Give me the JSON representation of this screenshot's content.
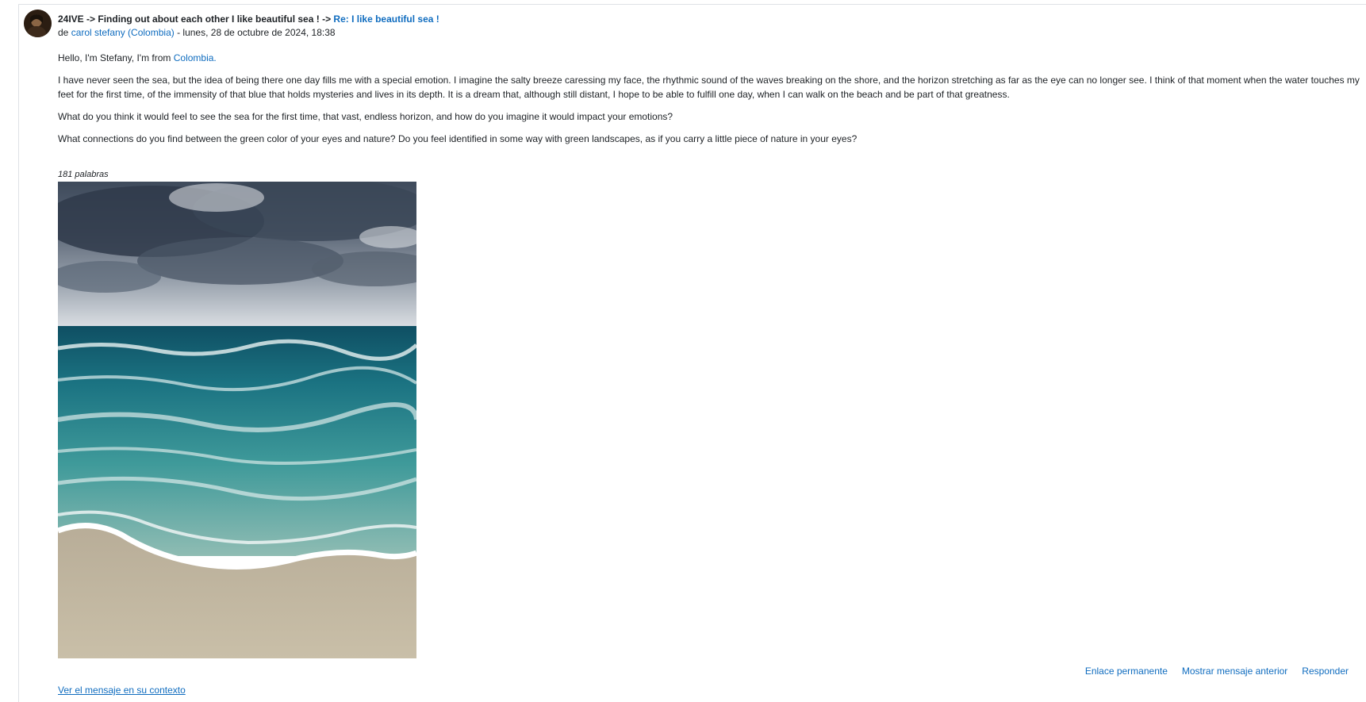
{
  "post": {
    "subject": {
      "course": "24IVE",
      "arrow1": " -> ",
      "forum": "Finding out about each other I like beautiful sea !",
      "arrow2": " -> ",
      "discussion_link": "Re: I like beautiful sea !"
    },
    "meta": {
      "prefix": "de ",
      "author": "carol stefany (Colombia)",
      "date": " - lunes, 28 de octubre de 2024, 18:38"
    },
    "body": {
      "p1_text": "Hello, I'm Stefany, I'm from ",
      "p1_link": "Colombia.",
      "p2": "I have never seen the sea, but the idea of being there one day fills me with a special emotion. I imagine the salty breeze caressing my face, the rhythmic sound of the waves breaking on the shore, and the horizon stretching as far as the eye can no longer see. I think of that moment when the water touches my feet for the first time, of the immensity of that blue that holds mysteries and lives in its depth. It is a dream that, although still distant, I hope to be able to fulfill one day, when I can walk on the beach and be part of that greatness.",
      "p3": "What do you think it would feel to see the sea for the first time, that vast, endless horizon, and how do you imagine it would impact your emotions?",
      "p4": "What connections do you find between the green color of your eyes and nature? Do you feel identified in some way with green landscapes, as if you carry a little piece of nature in your eyes?"
    },
    "word_count": "181 palabras",
    "actions": {
      "permalink": "Enlace permanente",
      "show_parent": "Mostrar mensaje anterior",
      "reply": "Responder"
    },
    "context_link": "Ver el mensaje en su contexto"
  },
  "colors": {
    "link": "#0f6cbf",
    "text": "#1d2125",
    "border": "#dee2e6"
  }
}
